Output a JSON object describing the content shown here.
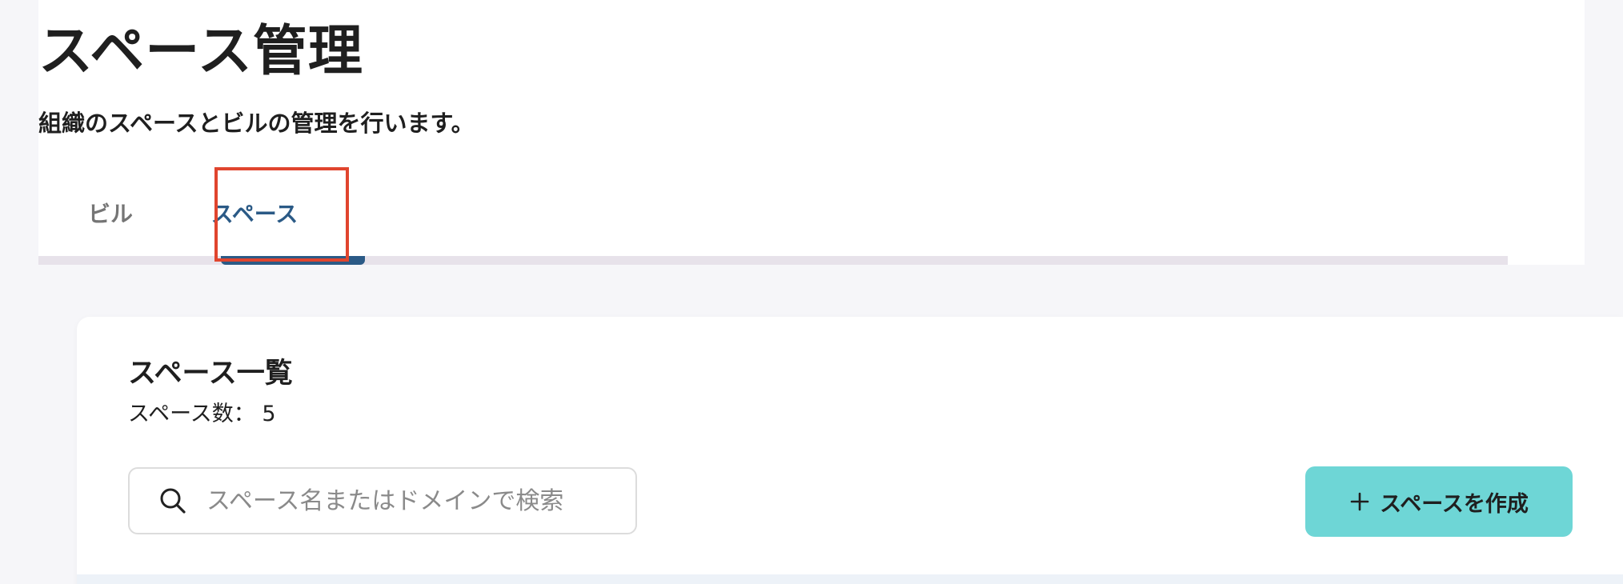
{
  "header": {
    "title": "スペース管理",
    "subtitle": "組織のスペースとビルの管理を行います。"
  },
  "tabs": [
    {
      "label": "ビル",
      "active": false
    },
    {
      "label": "スペース",
      "active": true
    }
  ],
  "space_list": {
    "title": "スペース一覧",
    "count_label": "スペース数： 5",
    "search": {
      "placeholder": "スペース名またはドメインで検索",
      "value": ""
    },
    "create_button_label": "スペースを作成"
  },
  "colors": {
    "accent": "#2b5a86",
    "button_bg": "#6ed6d6",
    "highlight_border": "#e0452e"
  },
  "icons": {
    "search": "search-icon",
    "plus": "plus-icon"
  }
}
